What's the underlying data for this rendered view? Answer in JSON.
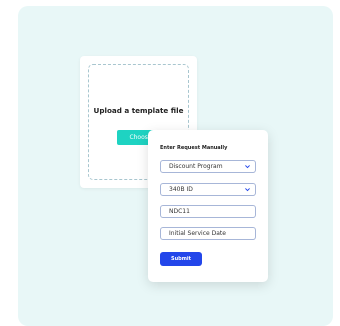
{
  "upload": {
    "title": "Upload a template file",
    "button_label": "Choose File"
  },
  "manual": {
    "title": "Enter Request Manually",
    "fields": [
      {
        "value": "Discount Program",
        "type": "select"
      },
      {
        "value": "340B ID",
        "type": "select"
      },
      {
        "value": "NDC11",
        "type": "text"
      },
      {
        "value": "Initial Service Date",
        "type": "text"
      }
    ],
    "submit_label": "Submit"
  },
  "colors": {
    "panel": "#e8f7f7",
    "choose_button": "#1ed3c2",
    "submit_button": "#2346ea",
    "field_border": "#a7b6d8"
  }
}
